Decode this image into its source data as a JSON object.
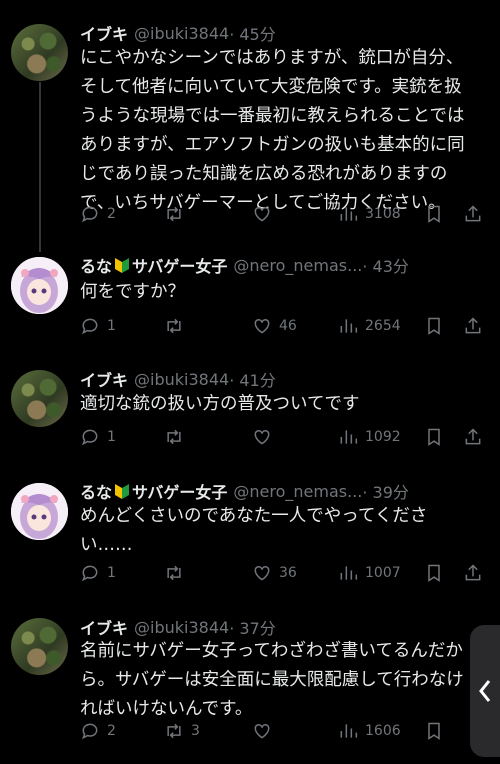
{
  "tweets": [
    {
      "name": "イブキ",
      "handle": "@ibuki3844",
      "time": "· 45分",
      "avatar": "moss-avatar",
      "lines": [
        "にこやかなシーンではありますが、銃口が自分、",
        "そして他者に向いていて大変危険です。実銃を扱",
        "うような現場では一番最初に教えられることでは",
        "ありますが、エアソフトガンの扱いも基本的に同",
        "じであり誤った知識を広める恐れがありますの",
        "で、いちサバゲーマーとしてご協力ください。"
      ],
      "replies": "2",
      "retweets": "",
      "likes": "",
      "views": "3108"
    },
    {
      "name": "るな",
      "name_suffix": "サバゲー女子",
      "handle": "@nero_nemas...",
      "time": "· 43分",
      "avatar": "anime-avatar",
      "lines": [
        "何をですか？"
      ],
      "replies": "1",
      "retweets": "",
      "likes": "46",
      "views": "2654"
    },
    {
      "name": "イブキ",
      "handle": "@ibuki3844",
      "time": "· 41分",
      "avatar": "moss-avatar",
      "lines": [
        "適切な銃の扱い方の普及ついてです"
      ],
      "replies": "1",
      "retweets": "",
      "likes": "",
      "views": "1092"
    },
    {
      "name": "るな",
      "name_suffix": "サバゲー女子",
      "handle": "@nero_nemas...",
      "time": "· 39分",
      "avatar": "anime-avatar",
      "lines": [
        "めんどくさいのであなた一人でやってくださ",
        "い……"
      ],
      "replies": "1",
      "retweets": "",
      "likes": "36",
      "views": "1007"
    },
    {
      "name": "イブキ",
      "handle": "@ibuki3844",
      "time": "· 37分",
      "avatar": "moss-avatar",
      "lines": [
        "名前にサバゲー女子ってわざわざ書いてるんだか",
        "ら。サバゲーは安全面に最大限配慮して行わなけ",
        "ればいけないんです。"
      ],
      "replies": "2",
      "retweets": "3",
      "likes": "",
      "views": "1606"
    }
  ],
  "colors": {
    "background": "#000000",
    "text": "#e7e9ea",
    "muted": "#71767b"
  }
}
